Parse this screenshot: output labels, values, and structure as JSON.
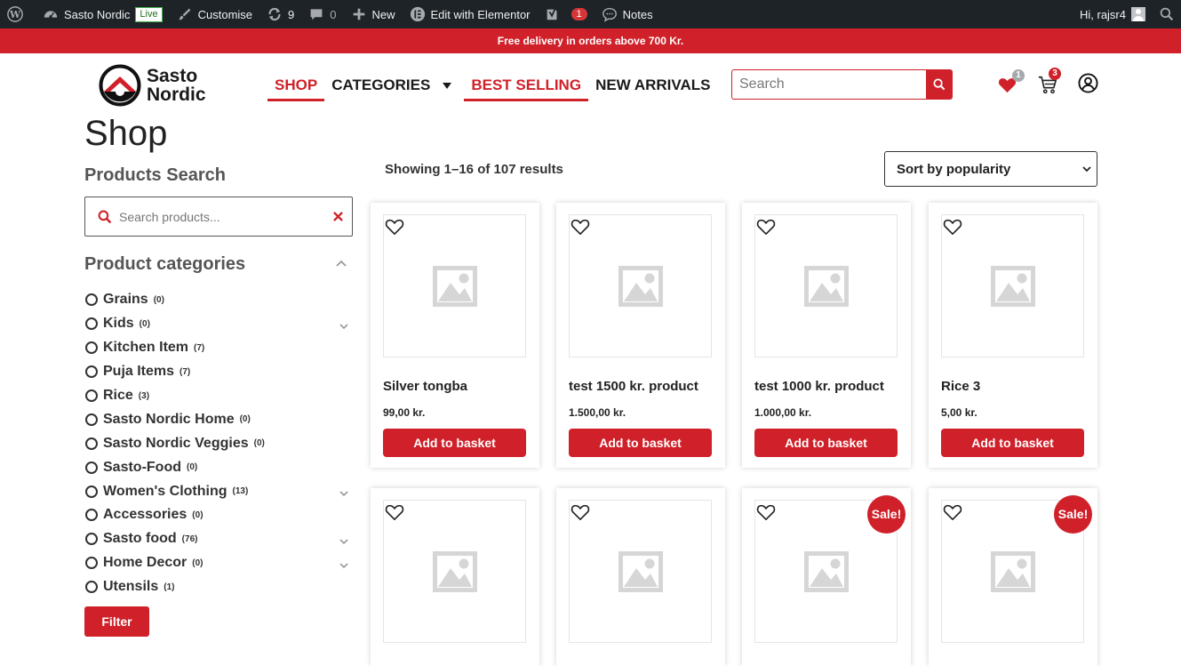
{
  "adminbar": {
    "site_name": "Sasto Nordic",
    "live_label": "Live",
    "customise": "Customise",
    "updates_count": "9",
    "comments_count": "0",
    "new_label": "New",
    "elementor": "Edit with Elementor",
    "yoast_count": "1",
    "notes": "Notes",
    "greeting": "Hi, rajsr4"
  },
  "promo": {
    "text": "Free delivery in orders above 700 Kr."
  },
  "header": {
    "logo_line1": "Sasto",
    "logo_line2": "Nordic",
    "nav": [
      {
        "label": "Shop",
        "active": true
      },
      {
        "label": "Categories",
        "active": false
      },
      {
        "label": "Best Selling",
        "active": true
      },
      {
        "label": "New Arrivals",
        "active": false
      }
    ],
    "search_placeholder": "Search",
    "wishlist_count": "1",
    "cart_count": "3"
  },
  "page": {
    "title": "Shop"
  },
  "sidebar": {
    "search_heading": "Products Search",
    "search_placeholder": "Search products...",
    "categories_heading": "Product categories",
    "categories": [
      {
        "name": "Grains",
        "count": "(0)",
        "expandable": false
      },
      {
        "name": "Kids",
        "count": "(0)",
        "expandable": true
      },
      {
        "name": "Kitchen Item",
        "count": "(7)",
        "expandable": false
      },
      {
        "name": "Puja Items",
        "count": "(7)",
        "expandable": false
      },
      {
        "name": "Rice",
        "count": "(3)",
        "expandable": false
      },
      {
        "name": "Sasto Nordic Home",
        "count": "(0)",
        "expandable": false
      },
      {
        "name": "Sasto Nordic Veggies",
        "count": "(0)",
        "expandable": false
      },
      {
        "name": "Sasto-Food",
        "count": "(0)",
        "expandable": false
      },
      {
        "name": "Women's Clothing",
        "count": "(13)",
        "expandable": true
      },
      {
        "name": "Accessories",
        "count": "(0)",
        "expandable": false
      },
      {
        "name": "Sasto food",
        "count": "(76)",
        "expandable": true
      },
      {
        "name": "Home Decor",
        "count": "(0)",
        "expandable": true
      },
      {
        "name": "Utensils",
        "count": "(1)",
        "expandable": false
      }
    ],
    "filter_label": "Filter"
  },
  "results": {
    "count_text": "Showing 1–16 of 107 results",
    "sort_selected": "Sort by popularity"
  },
  "products": [
    {
      "title": "Silver tongba",
      "price": "99,00 kr.",
      "button": "Add to basket",
      "sale": ""
    },
    {
      "title": "test 1500 kr. product",
      "price": "1.500,00 kr.",
      "button": "Add to basket",
      "sale": ""
    },
    {
      "title": "test 1000 kr. product",
      "price": "1.000,00 kr.",
      "button": "Add to basket",
      "sale": ""
    },
    {
      "title": "Rice 3",
      "price": "5,00 kr.",
      "button": "Add to basket",
      "sale": ""
    },
    {
      "title": "",
      "price": "",
      "button": "",
      "sale": ""
    },
    {
      "title": "",
      "price": "",
      "button": "",
      "sale": ""
    },
    {
      "title": "",
      "price": "",
      "button": "",
      "sale": "Sale!"
    },
    {
      "title": "",
      "price": "",
      "button": "",
      "sale": "Sale!"
    }
  ],
  "colors": {
    "brand_red": "#d0212a",
    "admin_bg": "#1d2327"
  }
}
